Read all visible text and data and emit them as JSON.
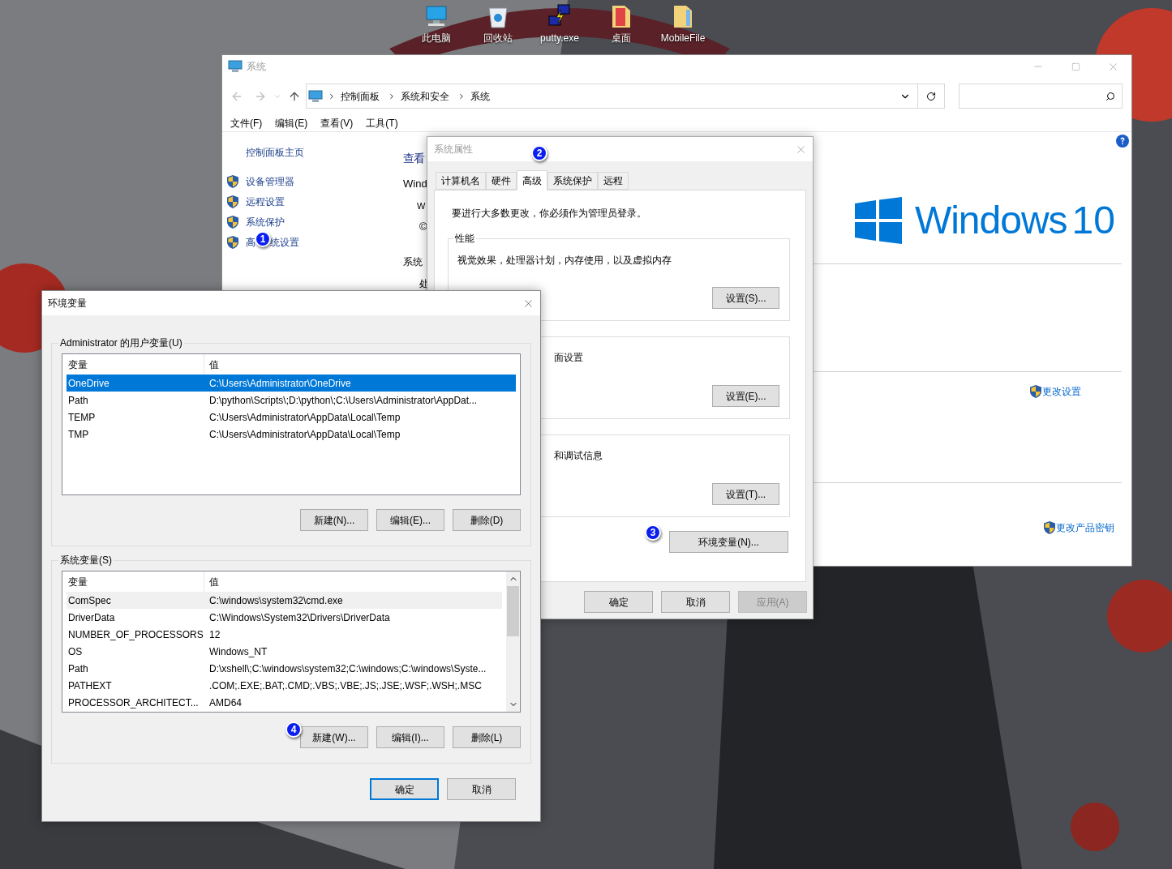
{
  "desktop_icons": [
    {
      "label": "此电脑",
      "kind": "computer"
    },
    {
      "label": "回收站",
      "kind": "recycle"
    },
    {
      "label": "putty.exe",
      "kind": "putty"
    },
    {
      "label": "桌面",
      "kind": "pdf"
    },
    {
      "label": "MobileFile",
      "kind": "folder"
    }
  ],
  "system_window": {
    "title": "系统",
    "breadcrumb": [
      "控制面板",
      "系统和安全",
      "系统"
    ],
    "menu": [
      "文件(F)",
      "编辑(E)",
      "查看(V)",
      "工具(T)"
    ],
    "sidebar": {
      "home": "控制面板主页",
      "items": [
        {
          "text": "设备管理器"
        },
        {
          "text": "远程设置"
        },
        {
          "text": "系统保护"
        },
        {
          "text": "高",
          "after_badge": "统设置"
        }
      ]
    },
    "fragments": {
      "heading": "查看",
      "edition": "Wind",
      "line_1": "W",
      "line_2": "©",
      "section": "系统",
      "line_3": "处"
    },
    "logo": {
      "word": "Windows",
      "version": "10"
    },
    "links": [
      "更改设置",
      "更改产品密钥"
    ]
  },
  "system_properties": {
    "title": "系统属性",
    "tabs": [
      {
        "label": "计算机名",
        "selected": false
      },
      {
        "label": "硬件",
        "selected": false
      },
      {
        "label": "高级",
        "selected": true
      },
      {
        "label": "系统保护",
        "selected": false
      },
      {
        "label": "远程",
        "selected": false
      }
    ],
    "notice": "要进行大多数更改，你必须作为管理员登录。",
    "groups": [
      {
        "legend": "性能",
        "text": "视觉效果，处理器计划，内存使用，以及虚拟内存",
        "button": "设置(S)..."
      },
      {
        "text": "面设置",
        "button": "设置(E)..."
      },
      {
        "text": "和调试信息",
        "button": "设置(T)..."
      }
    ],
    "env_button": "环境变量(N)...",
    "buttons": [
      {
        "label": "确定",
        "disabled": false
      },
      {
        "label": "取消",
        "disabled": false
      },
      {
        "label": "应用(A)",
        "disabled": true
      }
    ]
  },
  "env_dialog": {
    "title": "环境变量",
    "user": {
      "legend": "Administrator 的用户变量(U)",
      "columns": [
        "变量",
        "值"
      ],
      "rows": [
        {
          "name": "OneDrive",
          "value": "C:\\Users\\Administrator\\OneDrive",
          "selected": true
        },
        {
          "name": "Path",
          "value": "D:\\python\\Scripts\\;D:\\python\\;C:\\Users\\Administrator\\AppDat...",
          "selected": false
        },
        {
          "name": "TEMP",
          "value": "C:\\Users\\Administrator\\AppData\\Local\\Temp",
          "selected": false
        },
        {
          "name": "TMP",
          "value": "C:\\Users\\Administrator\\AppData\\Local\\Temp",
          "selected": false
        }
      ],
      "buttons": [
        "新建(N)...",
        "编辑(E)...",
        "删除(D)"
      ]
    },
    "system": {
      "legend": "系统变量(S)",
      "columns": [
        "变量",
        "值"
      ],
      "rows": [
        {
          "name": "ComSpec",
          "value": "C:\\windows\\system32\\cmd.exe",
          "selected": true
        },
        {
          "name": "DriverData",
          "value": "C:\\Windows\\System32\\Drivers\\DriverData",
          "selected": false
        },
        {
          "name": "NUMBER_OF_PROCESSORS",
          "value": "12",
          "selected": false
        },
        {
          "name": "OS",
          "value": "Windows_NT",
          "selected": false
        },
        {
          "name": "Path",
          "value": "D:\\xshell\\;C:\\windows\\system32;C:\\windows;C:\\windows\\Syste...",
          "selected": false
        },
        {
          "name": "PATHEXT",
          "value": ".COM;.EXE;.BAT;.CMD;.VBS;.VBE;.JS;.JSE;.WSF;.WSH;.MSC",
          "selected": false
        },
        {
          "name": "PROCESSOR_ARCHITECT...",
          "value": "AMD64",
          "selected": false
        }
      ],
      "buttons": [
        "新建(W)...",
        "编辑(I)...",
        "删除(L)"
      ]
    },
    "buttons": [
      {
        "label": "确定",
        "default": true
      },
      {
        "label": "取消",
        "default": false
      }
    ]
  },
  "step_badges": [
    "1",
    "2",
    "3",
    "4"
  ]
}
